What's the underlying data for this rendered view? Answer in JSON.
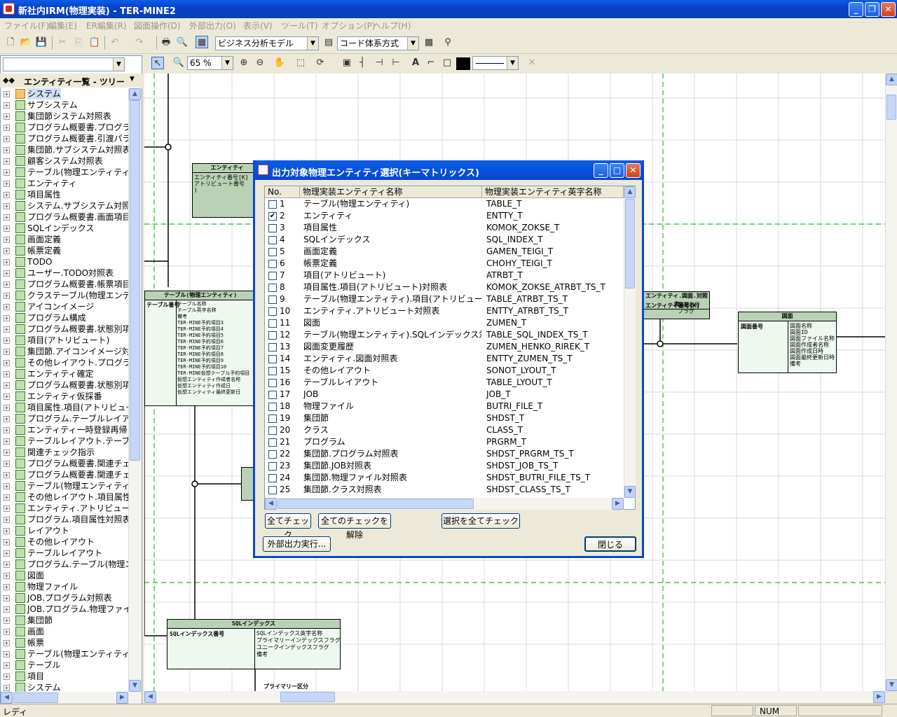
{
  "window": {
    "title": "新社内IRM(物理実装) - TER-MINE2"
  },
  "menu": [
    "ファイル(F)",
    "編集(E)",
    "ER編集(R)",
    "図面操作(D)",
    "外部出力(O)",
    "表示(V)",
    "ツール(T)",
    "オプション(P)",
    "ヘルプ(H)"
  ],
  "toolbar": {
    "model_select": "ビジネス分析モデル",
    "code_select": "コード体系方式",
    "zoom": "65 %"
  },
  "left_panel": {
    "header": "エンティティ一覧 - ツリー",
    "items": [
      "システム",
      "サブシステム",
      "集団節システム対照表",
      "プログラム概要書.プログラムアクション",
      "プログラム概要書.引渡パラメータ",
      "集団節.サブシステム対照表",
      "顧客システム対照表",
      "テーブル(物理エンティティ)",
      "エンティティ",
      "項目属性",
      "システム.サブシステム対照表",
      "プログラム概要書.画面項目表",
      "SQLインデックス",
      "画面定義",
      "帳票定義",
      "TODO",
      "ユーザー.TODO対照表",
      "プログラム概要書.帳票項目印",
      "クラステーブル(物理エンティティ)",
      "アイコンイメージ",
      "プログラム構成",
      "プログラム概要書.状態別項目",
      "項目(アトリビュート)",
      "集団節.アイコンイメージ対照表",
      "その他レイアウト.プログラム対照",
      "エンティティ確定",
      "プログラム概要書.状態別項目",
      "エンティティ仮採番",
      "項目属性.項目(アトリビュート)対",
      "プログラム.テーブルレイアウト対",
      "エンティティ一時登録再帰",
      "テーブルレイアウト.テーブル(物理",
      "関連チェック指示",
      "プログラム概要書.関連チェック対",
      "プログラム概要書.関連チェック対",
      "テーブル(物理エンティティ).項目",
      "その他レイアウト.項目属性対照",
      "エンティティ.アトリビュート対照表",
      "プログラム.項目属性対照表",
      "レイアウト",
      "その他レイアウト",
      "テーブルレイアウト",
      "プログラム.テーブル(物理エンティ",
      "図面",
      "物理ファイル",
      "JOB.プログラム対照表",
      "JOB.プログラム.物理ファイル対",
      "集団節",
      "画面",
      "帳票",
      "テーブル(物理エンティティ).SQL",
      "テーブル",
      "項目",
      "システム"
    ]
  },
  "dialog": {
    "title": "出力対象物理エンティティ選択(キーマトリックス)",
    "columns": [
      "No.",
      "物理実装エンティティ名称",
      "物理実装エンティティ英字名称"
    ],
    "rows": [
      {
        "no": "1",
        "name": "テーブル(物理エンティティ)",
        "en": "TABLE_T",
        "checked": false
      },
      {
        "no": "2",
        "name": "エンティティ",
        "en": "ENTTY_T",
        "checked": true
      },
      {
        "no": "3",
        "name": "項目属性",
        "en": "KOMOK_ZOKSE_T",
        "checked": false
      },
      {
        "no": "4",
        "name": "SQLインデックス",
        "en": "SQL_INDEX_T",
        "checked": false
      },
      {
        "no": "5",
        "name": "画面定義",
        "en": "GAMEN_TEIGI_T",
        "checked": false
      },
      {
        "no": "6",
        "name": "帳票定義",
        "en": "CHOHY_TEIGI_T",
        "checked": false
      },
      {
        "no": "7",
        "name": "項目(アトリビュート)",
        "en": "ATRBT_T",
        "checked": false
      },
      {
        "no": "8",
        "name": "項目属性.項目(アトリビュート)対照表",
        "en": "KOMOK_ZOKSE_ATRBT_TS_T",
        "checked": false
      },
      {
        "no": "9",
        "name": "テーブル(物理エンティティ).項目(アトリビュート)対照...",
        "en": "TABLE_ATRBT_TS_T",
        "checked": false
      },
      {
        "no": "10",
        "name": "エンティティ.アトリビュート対照表",
        "en": "ENTTY_ATRBT_TS_T",
        "checked": false
      },
      {
        "no": "11",
        "name": "図面",
        "en": "ZUMEN_T",
        "checked": false
      },
      {
        "no": "12",
        "name": "テーブル(物理エンティティ).SQLインデックス対照表",
        "en": "TABLE_SQL_INDEX_TS_T",
        "checked": false
      },
      {
        "no": "13",
        "name": "図面変更履歴",
        "en": "ZUMEN_HENKO_RIREK_T",
        "checked": false
      },
      {
        "no": "14",
        "name": "エンティティ.図面対照表",
        "en": "ENTTY_ZUMEN_TS_T",
        "checked": false
      },
      {
        "no": "15",
        "name": "その他レイアウト",
        "en": "SONOT_LYOUT_T",
        "checked": false
      },
      {
        "no": "16",
        "name": "テーブルレイアウト",
        "en": "TABLE_LYOUT_T",
        "checked": false
      },
      {
        "no": "17",
        "name": "JOB",
        "en": "JOB_T",
        "checked": false
      },
      {
        "no": "18",
        "name": "物理ファイル",
        "en": "BUTRI_FILE_T",
        "checked": false
      },
      {
        "no": "19",
        "name": "集団節",
        "en": "SHDST_T",
        "checked": false
      },
      {
        "no": "20",
        "name": "クラス",
        "en": "CLASS_T",
        "checked": false
      },
      {
        "no": "21",
        "name": "プログラム",
        "en": "PRGRM_T",
        "checked": false
      },
      {
        "no": "22",
        "name": "集団節.プログラム対照表",
        "en": "SHDST_PRGRM_TS_T",
        "checked": false
      },
      {
        "no": "23",
        "name": "集団節.JOB対照表",
        "en": "SHDST_JOB_TS_T",
        "checked": false
      },
      {
        "no": "24",
        "name": "集団節.物理ファイル対照表",
        "en": "SHDST_BUTRI_FILE_TS_T",
        "checked": false
      },
      {
        "no": "25",
        "name": "集団節.クラス対照表",
        "en": "SHDST_CLASS_TS_T",
        "checked": false
      }
    ],
    "buttons": {
      "check_all": "全てチェック",
      "uncheck_all": "全てのチェックを解除",
      "check_selected": "選択を全てチェック",
      "export": "外部出力実行...",
      "close": "閉じる"
    }
  },
  "canvas": {
    "entity_sql": {
      "title": "SQLインデックス",
      "key": "SQLインデックス番号",
      "attrs": "SQLインデックス英字名称\nプライマリーインデックスフラグ\nユニークインデックスフラグ\n備考"
    },
    "entity_zumen": {
      "title": "図面",
      "key": "図面番号",
      "attrs": "図面名称\n図面ID\n図面ファイル名称\n図面作成者名称\n図面作成日時\n図面最終更新日時\n備考"
    },
    "entity_table": {
      "title": "テーブル(物理エンティティ)",
      "key": "テーブル番号",
      "attrs": "テーブル名称\nテーブル英字名称\n備考\nTER-MINE予約項目3\nTER-MINE予約項目4\nTER-MINE予約項目5\nTER-MINE予約項目6\nTER-MINE予約項目7\nTER-MINE予約項目8\nTER-MINE予約項目9\nTER-MINE予約項目10\nTER-MINE仮想テーブル予約項目\n仮想エンティティ作成者名称\n仮想エンティティ作成日\n仮想エンティティ最終更新日"
    },
    "entity_top": {
      "title": "エンティティ",
      "text": "エンティティ番号[K]\nアトリビュート番号\n)"
    },
    "entity_right": {
      "title": "エンティティ.図面.対照表",
      "key": "エンティティ番号[K]",
      "attrs": "図面番号\nフラグ"
    },
    "primary_label": "プライマリー区分"
  },
  "status": {
    "left": "レディ",
    "num": "NUM"
  }
}
